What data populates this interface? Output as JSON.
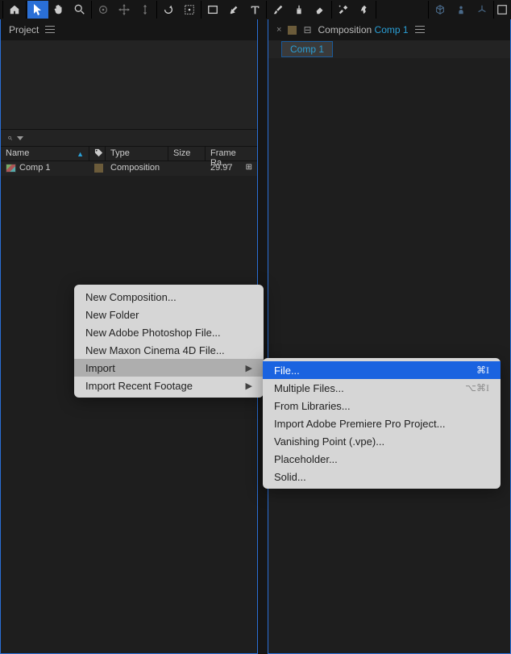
{
  "panels": {
    "project_title": "Project",
    "composition_label": "Composition",
    "composition_active": "Comp 1",
    "comp_tab": "Comp 1"
  },
  "asset_table": {
    "headers": {
      "name": "Name",
      "tag": "",
      "type": "Type",
      "size": "Size",
      "frame": "Frame Ra..."
    },
    "row": {
      "name": "Comp 1",
      "type": "Composition",
      "size": "",
      "frame": "29.97"
    }
  },
  "context_menu": {
    "items": [
      "New Composition...",
      "New Folder",
      "New Adobe Photoshop File...",
      "New Maxon Cinema 4D File...",
      "Import",
      "Import Recent Footage"
    ]
  },
  "import_submenu": {
    "items": [
      {
        "label": "File...",
        "shortcut": "⌘I",
        "highlight": true
      },
      {
        "label": "Multiple Files...",
        "shortcut": "⌥⌘I",
        "dim": true
      },
      {
        "label": "From Libraries..."
      },
      {
        "label": "Import Adobe Premiere Pro Project..."
      },
      {
        "label": "Vanishing Point (.vpe)..."
      },
      {
        "label": "Placeholder..."
      },
      {
        "label": "Solid..."
      }
    ]
  }
}
